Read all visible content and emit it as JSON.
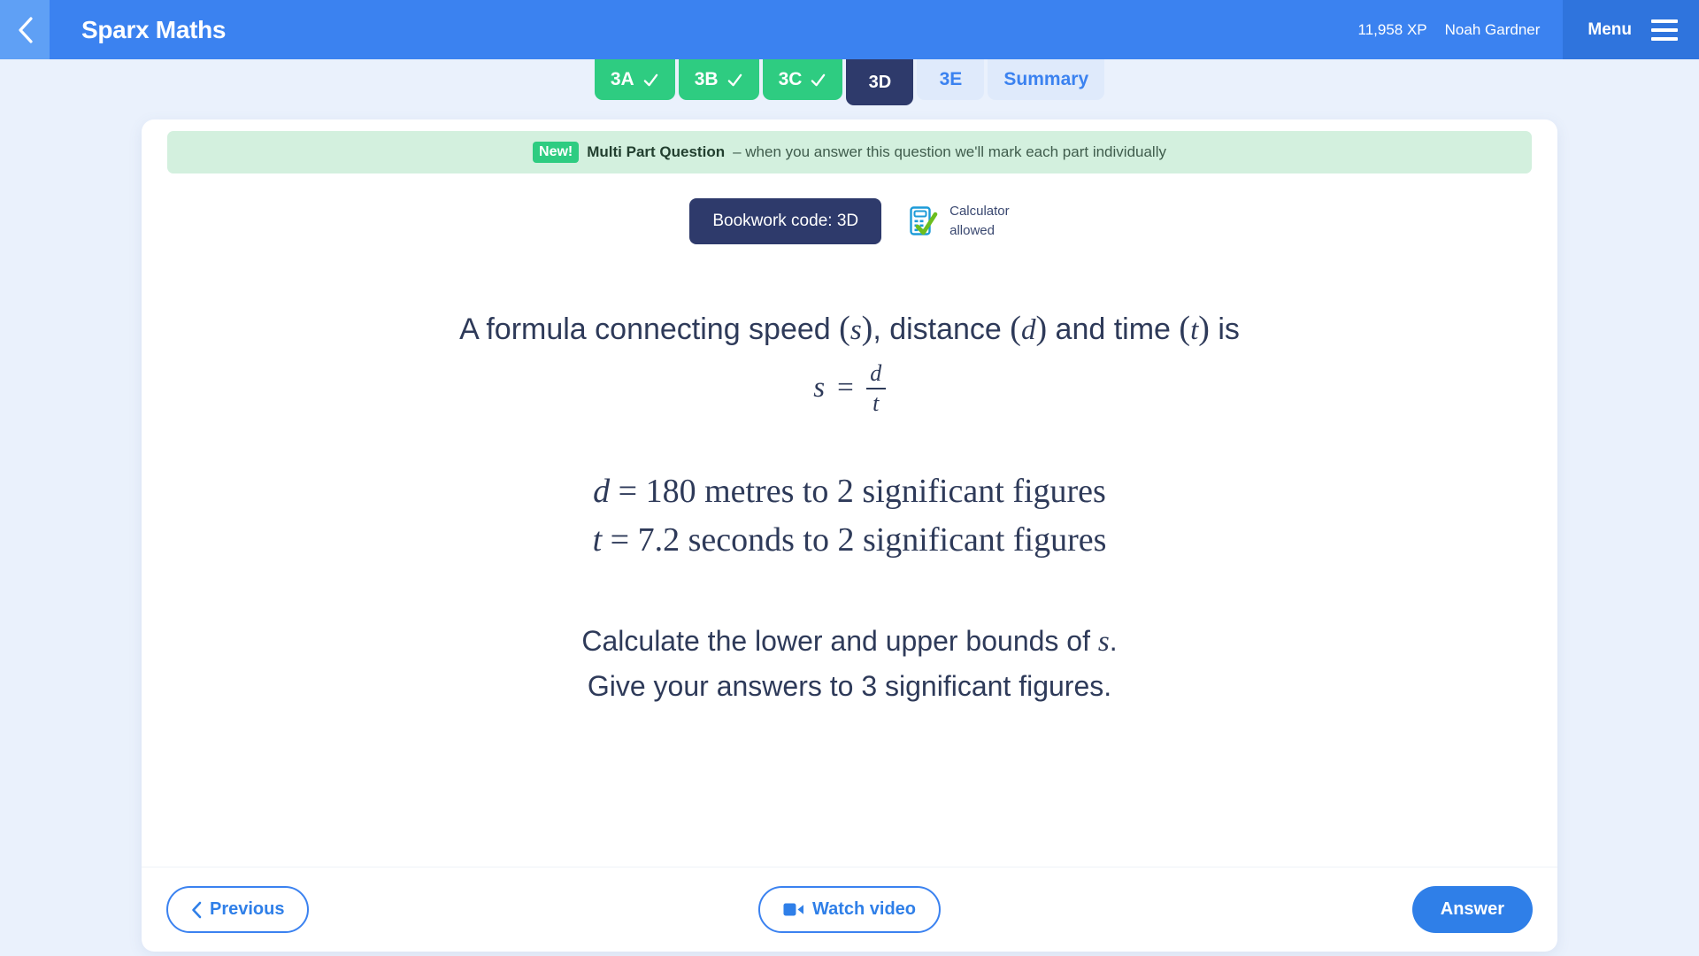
{
  "header": {
    "back_icon": "chevron-left-icon",
    "brand": "Sparx Maths",
    "xp": "11,958 XP",
    "user": "Noah Gardner",
    "menu_label": "Menu",
    "menu_icon": "hamburger-icon",
    "colors": {
      "bar": "#3b82f0",
      "back_panel": "#5fa0f5",
      "menu_panel": "#2f74dd"
    }
  },
  "tabs": [
    {
      "label": "3A",
      "state": "done",
      "icon": "check-icon"
    },
    {
      "label": "3B",
      "state": "done",
      "icon": "check-icon"
    },
    {
      "label": "3C",
      "state": "done",
      "icon": "check-icon"
    },
    {
      "label": "3D",
      "state": "active",
      "icon": ""
    },
    {
      "label": "3E",
      "state": "todo",
      "icon": ""
    },
    {
      "label": "Summary",
      "state": "todo",
      "icon": ""
    }
  ],
  "banner": {
    "badge": "New!",
    "title": "Multi Part Question",
    "rest": "– when you answer this question we'll mark each part individually",
    "bg_color": "#d3f0de",
    "badge_color": "#2ecc81"
  },
  "meta": {
    "bookwork_code": "Bookwork code: 3D",
    "calculator_icon": "calculator-check-icon",
    "calculator_line1": "Calculator",
    "calculator_line2": "allowed"
  },
  "question": {
    "intro_a": "A formula connecting speed ",
    "intro_s": "s",
    "intro_b": ", distance ",
    "intro_d": "d",
    "intro_c": " and time ",
    "intro_t": "t",
    "intro_end": " is",
    "formula_lhs": "s",
    "formula_eq": "=",
    "formula_num": "d",
    "formula_den": "t",
    "given_d_var": "d",
    "given_d_eq": "=",
    "given_d_val": "180",
    "given_d_text": "metres to 2 significant figures",
    "given_t_var": "t",
    "given_t_eq": "=",
    "given_t_val": "7.2",
    "given_t_text": "seconds to 2 significant figures",
    "ask_line1_a": "Calculate the lower and upper bounds of ",
    "ask_line1_var": "s",
    "ask_line1_b": ".",
    "ask_line2": "Give your answers to 3 significant figures."
  },
  "footer": {
    "previous": "Previous",
    "previous_icon": "chevron-left-icon",
    "watch_video": "Watch video",
    "watch_video_icon": "video-camera-icon",
    "answer": "Answer"
  }
}
